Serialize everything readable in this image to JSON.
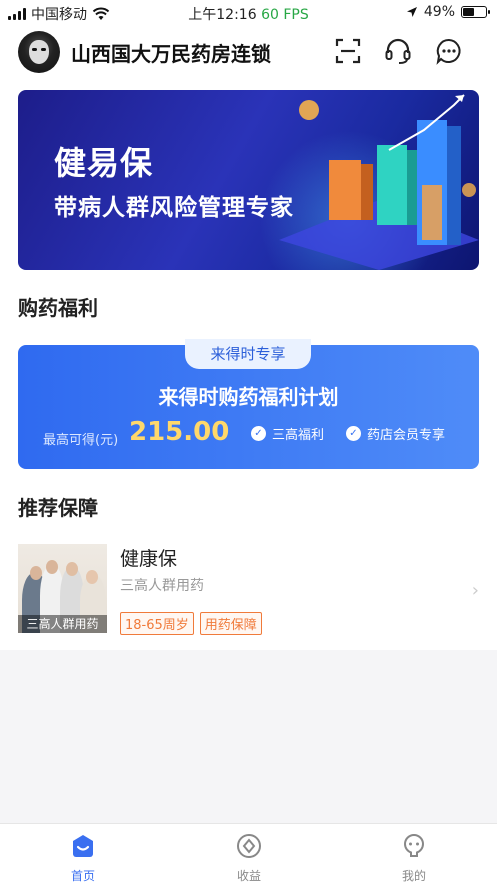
{
  "status_bar": {
    "carrier": "中国移动",
    "time": "上午12:16",
    "fps": "60 FPS",
    "battery": "49%",
    "battery_level": 0.49
  },
  "header": {
    "title": "山西国大万民药房连锁",
    "icons": [
      "scan-icon",
      "headset-icon",
      "chat-icon"
    ]
  },
  "banner": {
    "title": "健易保",
    "subtitle": "带病人群风险管理专家"
  },
  "welfare_section": {
    "title": "购药福利",
    "card": {
      "tag": "来得时专享",
      "title": "来得时购药福利计划",
      "max_label": "最高可得(元)",
      "amount": "215.00",
      "benefits": [
        "三高福利",
        "药店会员专享"
      ]
    }
  },
  "recommend_section": {
    "title": "推荐保障",
    "product": {
      "name": "健康保",
      "desc": "三高人群用药",
      "image_caption": "三高人群用药",
      "tags": [
        "18-65周岁",
        "用药保障"
      ]
    }
  },
  "tabbar": {
    "items": [
      {
        "label": "首页",
        "icon": "home-icon",
        "active": true
      },
      {
        "label": "收益",
        "icon": "earnings-icon",
        "active": false
      },
      {
        "label": "我的",
        "icon": "profile-icon",
        "active": false
      }
    ],
    "active_color": "#3a6ff0",
    "inactive_color": "#888888"
  }
}
